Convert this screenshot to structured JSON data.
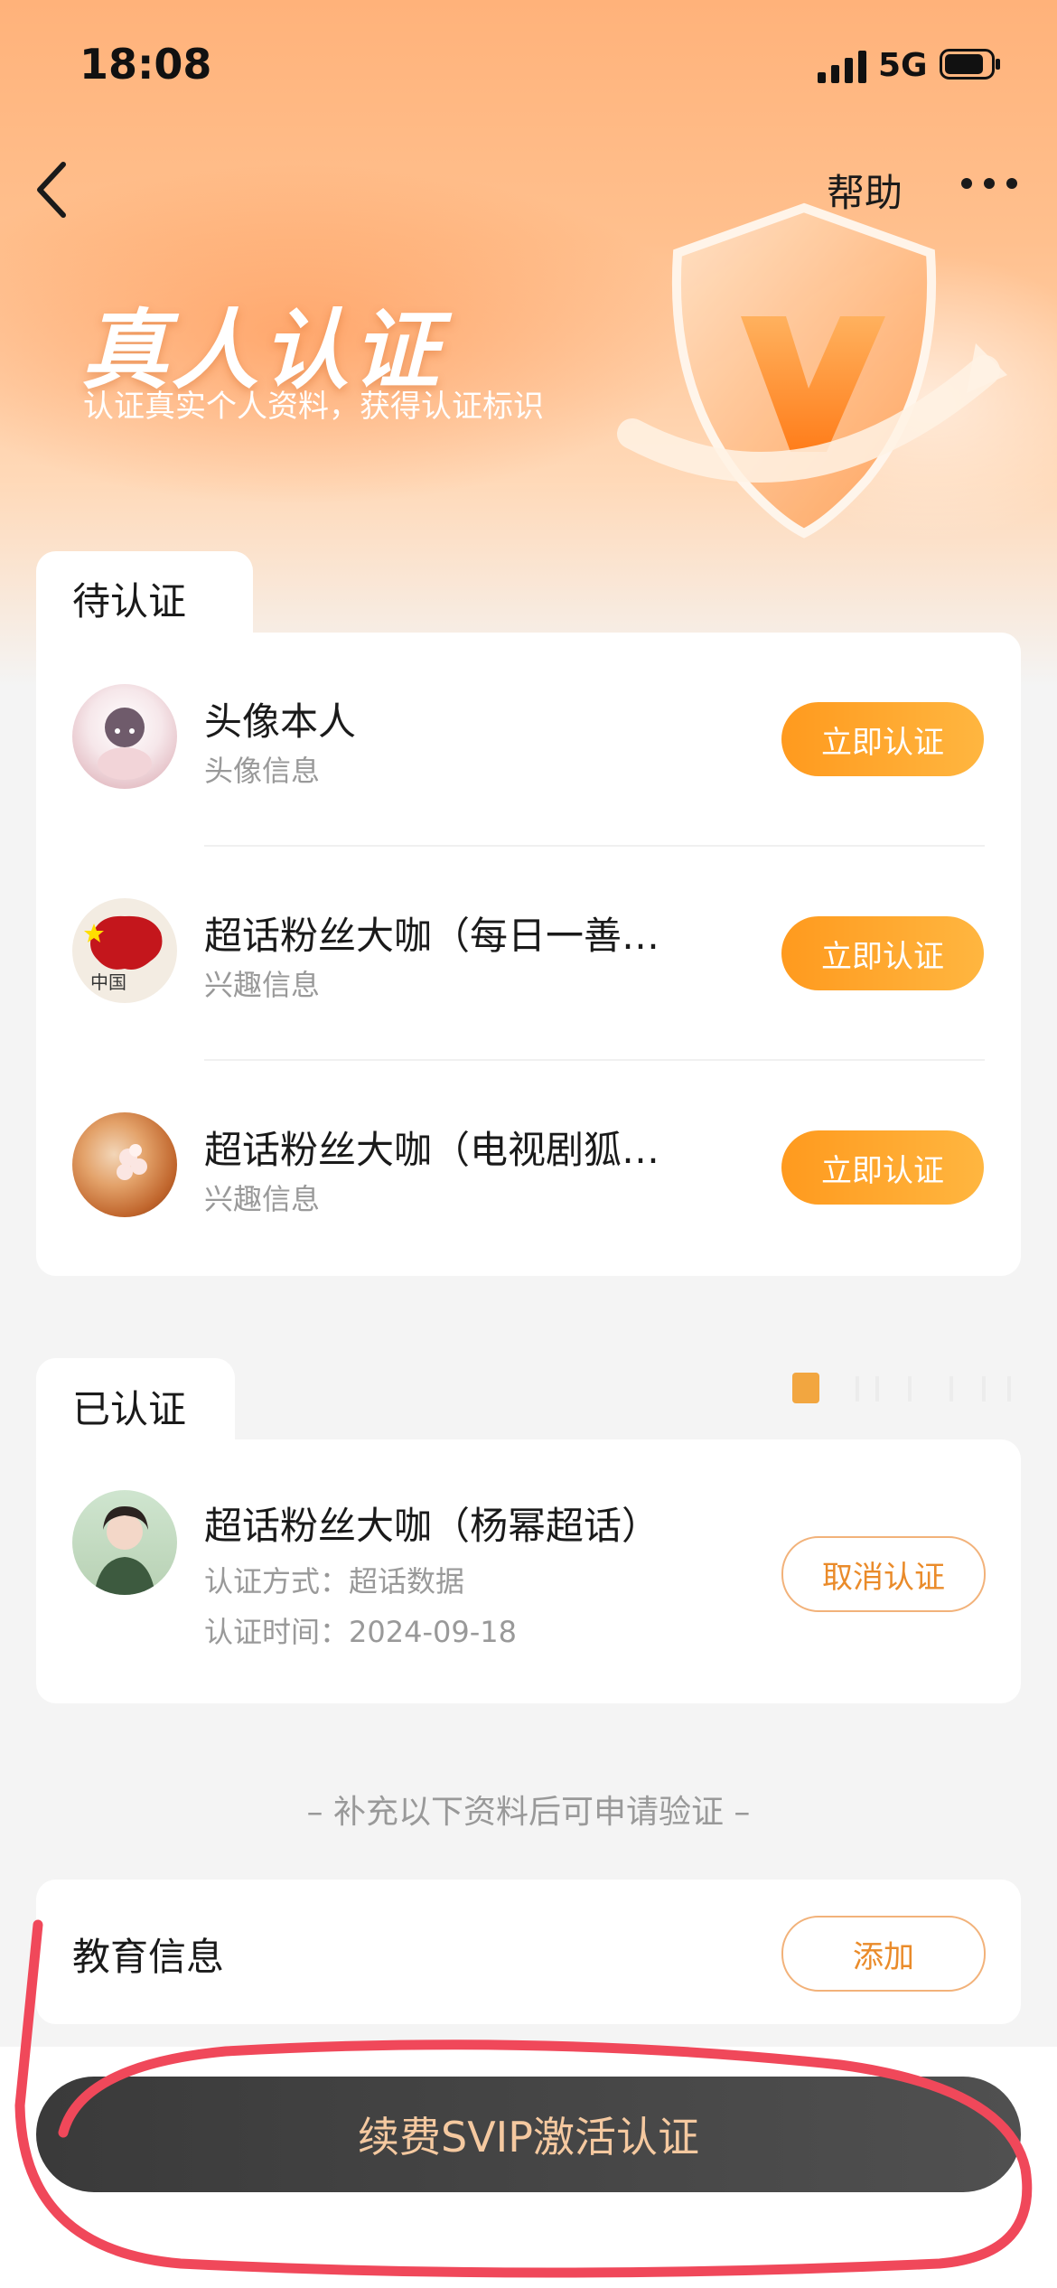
{
  "status_bar": {
    "time": "18:08",
    "network": "5G"
  },
  "nav": {
    "help_label": "帮助"
  },
  "hero": {
    "title": "真人认证",
    "subtitle": "认证真实个人资料，获得认证标识"
  },
  "pending": {
    "tab_label": "待认证",
    "items": [
      {
        "title": "头像本人",
        "subtitle": "头像信息",
        "button": "立即认证"
      },
      {
        "title": "超话粉丝大咖（每日一善…",
        "subtitle": "兴趣信息",
        "button": "立即认证"
      },
      {
        "title": "超话粉丝大咖（电视剧狐…",
        "subtitle": "兴趣信息",
        "button": "立即认证"
      }
    ]
  },
  "verified": {
    "tab_label": "已认证",
    "item": {
      "title": "超话粉丝大咖（杨幂超话）",
      "method_label": "认证方式：",
      "method_value": "超话数据",
      "time_label": "认证时间：",
      "time_value": "2024-09-18",
      "button": "取消认证"
    }
  },
  "hint": "– 补充以下资料后可申请验证 –",
  "education": {
    "label": "教育信息",
    "button": "添加"
  },
  "renew_button": "续费SVIP激活认证",
  "colors": {
    "accent": "#ff9a1e",
    "annotation": "#f0485a"
  }
}
